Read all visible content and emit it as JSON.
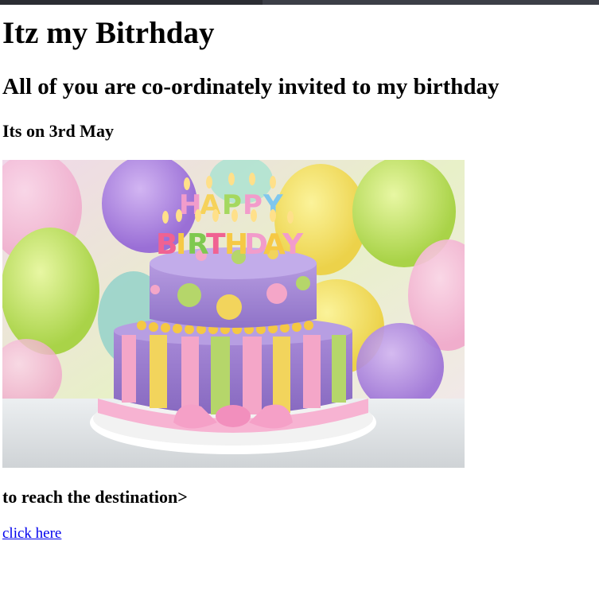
{
  "page": {
    "title": "Itz my Bitrhday",
    "subtitle": "All of you are co-ordinately invited to my birthday",
    "date_line": "Its on 3rd May",
    "image_caption_letters": "HAPPY BIRTHDAY",
    "reach_text": "to reach the destination>",
    "link_text": "click here"
  },
  "colors": {
    "link": "#0000ee",
    "cake_purple": "#9f7fd0",
    "cake_pink": "#f4a6c8",
    "cake_yellow": "#f2d45c",
    "cake_green": "#b5d66a"
  },
  "icons": {
    "image": "birthday-cake-image"
  }
}
